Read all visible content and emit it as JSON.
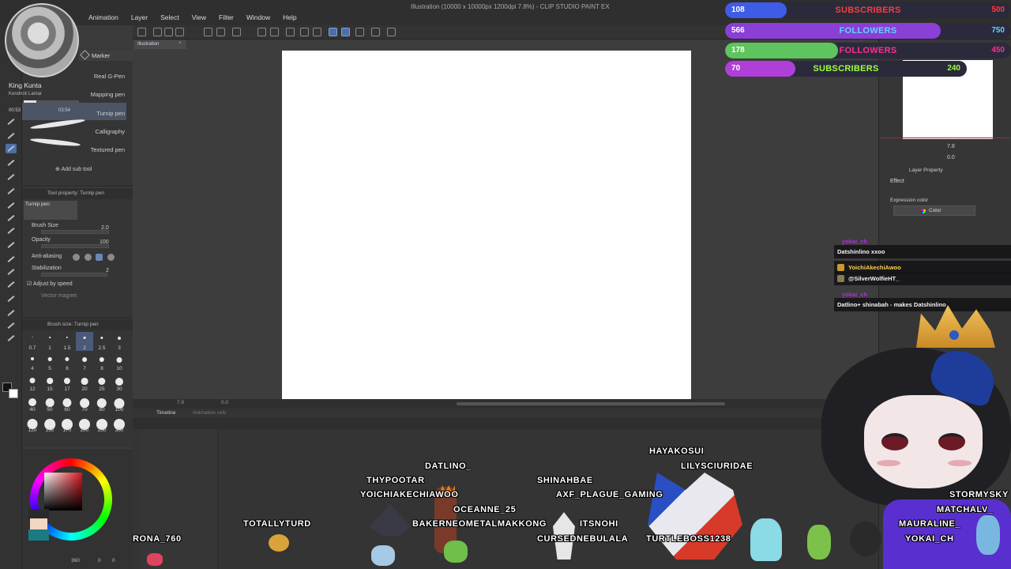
{
  "window": {
    "title": "Illustration (10000 x 10000px 1200dpi 7.8%) - CLIP STUDIO PAINT EX",
    "menus": [
      "Animation",
      "Layer",
      "Select",
      "View",
      "Filter",
      "Window",
      "Help"
    ],
    "document_tab": "Illustration",
    "document_tab_close": "×"
  },
  "media_player": {
    "song": "King Kunta",
    "artist": "Kendrick Lamar",
    "elapsed": "00:53",
    "duration": "03:54",
    "progress": 0.23
  },
  "sub_tool": {
    "group_tab": "Marker",
    "brushes": [
      "Real G-Pen",
      "Mapping pen",
      "Turnip pen",
      "Calligraphy",
      "Textured pen"
    ],
    "selected_brush": "Turnip pen",
    "add_sub_tool": "Add sub tool"
  },
  "tool_property": {
    "header": "Tool property: Turnip pen",
    "preview_label": "Turnip pen",
    "brush_size_label": "Brush Size",
    "brush_size_value": "2.0",
    "opacity_label": "Opacity",
    "opacity_value": "100",
    "antialias_label": "Anti-aliasing",
    "stabilization_label": "Stabilization",
    "stabilization_value": "2",
    "adjust_speed_label": "Adjust by speed",
    "vector_magnet_label": "Vector magnet"
  },
  "brush_size": {
    "header": "Brush size: Turnip pen",
    "sizes": [
      "0.7",
      "1",
      "1.5",
      "2",
      "2.5",
      "3",
      "4",
      "5",
      "6",
      "7",
      "8",
      "10",
      "12",
      "15",
      "17",
      "20",
      "25",
      "30",
      "40",
      "50",
      "60",
      "70",
      "80",
      "100",
      "120",
      "150",
      "170",
      "200",
      "250",
      "300"
    ],
    "selected": "2"
  },
  "color_panel": {
    "readout": "360",
    "readout_2": "0",
    "readout_3": "0"
  },
  "canvas": {
    "status_zoom": "7.8",
    "status_angle": "0.0"
  },
  "timeline": {
    "tab": "Timeline",
    "tab2": "Animation cels"
  },
  "navigator": {
    "title": "Navigator",
    "zoom": "7.8",
    "angle": "0.0"
  },
  "layer_property": {
    "title": "Layer Property",
    "effect_label": "Effect",
    "expression_color_label": "Expression color",
    "expression_color_value": "Color"
  },
  "stream_goals": [
    {
      "current": "108",
      "label": "SUBSCRIBERS",
      "max": "500",
      "fill_fraction": 0.216,
      "fill_color": "#3f5ce6",
      "label_color": "#ff3b3b",
      "max_color": "#ff3b3b"
    },
    {
      "current": "566",
      "label": "FOLLOWERS",
      "max": "750",
      "fill_fraction": 0.755,
      "fill_color": "#8a3fd6",
      "label_color": "#5fd4ff",
      "max_color": "#5fd4ff"
    },
    {
      "current": "178",
      "label": "FOLLOWERS",
      "max": "450",
      "fill_fraction": 0.396,
      "fill_color": "#5ec45e",
      "label_color": "#ff2f8f",
      "max_color": "#ff2f8f"
    },
    {
      "current": "70",
      "label": "SUBSCRIBERS",
      "max": "240",
      "fill_fraction": 0.292,
      "fill_color": "#b03fd8",
      "label_color": "#9eff3f",
      "max_color": "#9eff3f"
    }
  ],
  "chat": [
    {
      "user": "yokai_ch",
      "user_color": "#b02fd8",
      "text": "Datshinlino xxoo"
    },
    {
      "user": "YoichiAkechiAwoo",
      "user_color": "#ffd24a",
      "text": "@SilverWolfieHT_"
    },
    {
      "user": "yokai_ch",
      "user_color": "#b02fd8",
      "text": "Datlino+ shinabah - makes Datshinlino"
    }
  ],
  "chatters": [
    "HAYAKOSUI",
    "DATLINO_",
    "LILYSCIURIDAE",
    "THYPOOTAR",
    "SHINAHBAE",
    "YOICHIAKECHIAWOO",
    "AXF_PLAGUE_GAMING",
    "STORMYSKY",
    "OCEANNE_25",
    "MATCHALV_",
    "BAKERNEOMETALMAKKONG",
    "ITSNOHI",
    "MAURALINE_",
    "TOTALLYTURD",
    "RONA_760",
    "CURSEDNEBULALA",
    "TURTLEBOSS1238",
    "YOKAI_CH"
  ]
}
